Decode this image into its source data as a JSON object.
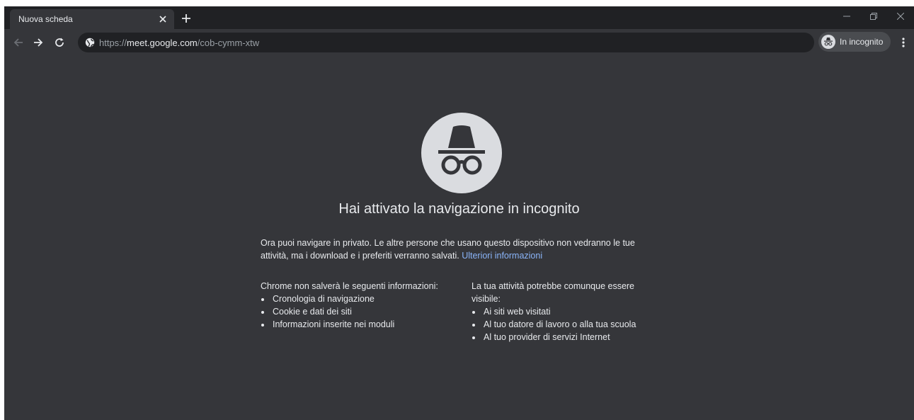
{
  "tab": {
    "title": "Nuova scheda",
    "close_icon": "close-icon",
    "new_tab_icon": "plus-icon"
  },
  "window_controls": [
    "minimize-icon",
    "restore-icon",
    "close-icon"
  ],
  "toolbar": {
    "back_icon": "arrow-left-icon",
    "forward_icon": "arrow-right-icon",
    "reload_icon": "reload-icon",
    "site_icon": "globe-icon",
    "url_scheme": "https://",
    "url_host": "meet.google.com",
    "url_path": "/cob-cymm-xtw",
    "incognito_label": "In incognito",
    "menu_icon": "more-vert-icon"
  },
  "content": {
    "headline": "Hai attivato la navigazione in incognito",
    "intro_text": "Ora puoi navigare in privato. Le altre persone che usano questo dispositivo non vedranno le tue attività, ma i download e i preferiti verranno salvati.",
    "learn_more": "Ulteriori informazioni",
    "left_heading": "Chrome non salverà le seguenti informazioni:",
    "left_items": [
      "Cronologia di navigazione",
      "Cookie e dati dei siti",
      "Informazioni inserite nei moduli"
    ],
    "right_heading": "La tua attività potrebbe comunque essere visibile:",
    "right_items": [
      "Ai siti web visitati",
      "Al tuo datore di lavoro o alla tua scuola",
      "Al tuo provider di servizi Internet"
    ]
  },
  "colors": {
    "frame": "#202124",
    "background": "#35363a",
    "text": "#e8eaed",
    "link": "#8ab4f8",
    "logo_circle": "#dadce0"
  }
}
